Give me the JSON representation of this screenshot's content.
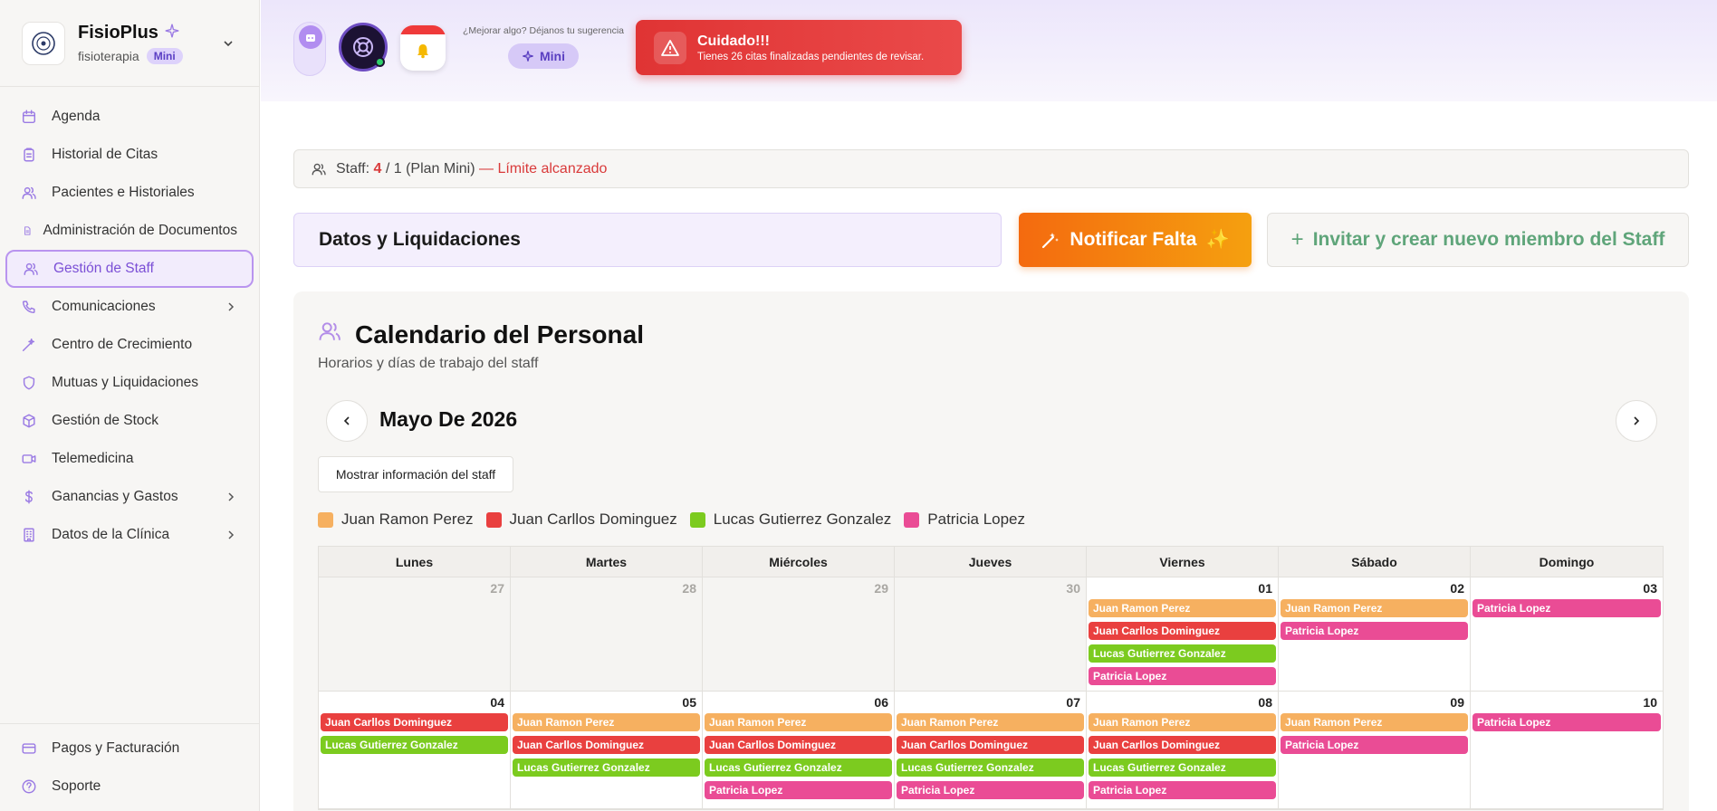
{
  "brand": {
    "name": "FisioPlus",
    "subtitle": "fisioterapia",
    "plan_badge": "Mini"
  },
  "sidebar": {
    "items": [
      {
        "label": "Agenda",
        "icon": "calendar-icon"
      },
      {
        "label": "Historial de Citas",
        "icon": "clipboard-icon"
      },
      {
        "label": "Pacientes e Historiales",
        "icon": "users-icon"
      },
      {
        "label": "Administración de Documentos",
        "icon": "document-icon"
      },
      {
        "label": "Gestión de Staff",
        "icon": "users-icon",
        "active": true
      },
      {
        "label": "Comunicaciones",
        "icon": "phone-icon",
        "has_submenu": true
      },
      {
        "label": "Centro de Crecimiento",
        "icon": "wand-icon"
      },
      {
        "label": "Mutuas y Liquidaciones",
        "icon": "shield-icon"
      },
      {
        "label": "Gestión de Stock",
        "icon": "box-icon"
      },
      {
        "label": "Telemedicina",
        "icon": "video-icon"
      },
      {
        "label": "Ganancias y Gastos",
        "icon": "dollar-icon",
        "has_submenu": true
      },
      {
        "label": "Datos de la Clínica",
        "icon": "building-icon",
        "has_submenu": true
      }
    ],
    "bottom": [
      {
        "label": "Pagos y Facturación",
        "icon": "credit-card-icon"
      },
      {
        "label": "Soporte",
        "icon": "help-icon"
      }
    ]
  },
  "topbar": {
    "suggestion_text": "¿Mejorar algo? Déjanos tu sugerencia",
    "suggestion_button": "Mini",
    "alert_title": "Cuidado!!!",
    "alert_message": "Tienes 26 citas finalizadas pendientes de revisar."
  },
  "staff_bar": {
    "prefix": "Staff: ",
    "count": "4",
    "limit": " / 1 (Plan Mini) ",
    "warning": "— Límite alcanzado"
  },
  "actions": {
    "datos_label": "Datos y Liquidaciones",
    "notificar_label": "Notificar Falta",
    "invitar_label": "Invitar y crear nuevo miembro del Staff"
  },
  "calendar": {
    "title": "Calendario del Personal",
    "subtitle": "Horarios y días de trabajo del staff",
    "month_label": "Mayo De 2026",
    "show_staff_button": "Mostrar información del staff",
    "weekdays": [
      "Lunes",
      "Martes",
      "Miércoles",
      "Jueves",
      "Viernes",
      "Sábado",
      "Domingo"
    ],
    "colors": {
      "Juan Ramon Perez": "#f6b060",
      "Juan Carllos Dominguez": "#e9403f",
      "Lucas Gutierrez Gonzalez": "#7ccb1f",
      "Patricia Lopez": "#ea4c95"
    },
    "legend": [
      "Juan Ramon Perez",
      "Juan Carllos Dominguez",
      "Lucas Gutierrez Gonzalez",
      "Patricia Lopez"
    ],
    "weeks": [
      [
        {
          "day": "27",
          "other": true,
          "events": []
        },
        {
          "day": "28",
          "other": true,
          "events": []
        },
        {
          "day": "29",
          "other": true,
          "events": []
        },
        {
          "day": "30",
          "other": true,
          "events": []
        },
        {
          "day": "01",
          "events": [
            "Juan Ramon Perez",
            "Juan Carllos Dominguez",
            "Lucas Gutierrez Gonzalez",
            "Patricia Lopez"
          ]
        },
        {
          "day": "02",
          "events": [
            "Juan Ramon Perez",
            "Patricia Lopez"
          ]
        },
        {
          "day": "03",
          "events": [
            "Patricia Lopez"
          ]
        }
      ],
      [
        {
          "day": "04",
          "events": [
            "Juan Carllos Dominguez",
            "Lucas Gutierrez Gonzalez"
          ]
        },
        {
          "day": "05",
          "events": [
            "Juan Ramon Perez",
            "Juan Carllos Dominguez",
            "Lucas Gutierrez Gonzalez"
          ]
        },
        {
          "day": "06",
          "events": [
            "Juan Ramon Perez",
            "Juan Carllos Dominguez",
            "Lucas Gutierrez Gonzalez",
            "Patricia Lopez"
          ]
        },
        {
          "day": "07",
          "events": [
            "Juan Ramon Perez",
            "Juan Carllos Dominguez",
            "Lucas Gutierrez Gonzalez",
            "Patricia Lopez"
          ]
        },
        {
          "day": "08",
          "events": [
            "Juan Ramon Perez",
            "Juan Carllos Dominguez",
            "Lucas Gutierrez Gonzalez",
            "Patricia Lopez"
          ]
        },
        {
          "day": "09",
          "events": [
            "Juan Ramon Perez",
            "Patricia Lopez"
          ]
        },
        {
          "day": "10",
          "events": [
            "Patricia Lopez"
          ]
        }
      ]
    ]
  }
}
